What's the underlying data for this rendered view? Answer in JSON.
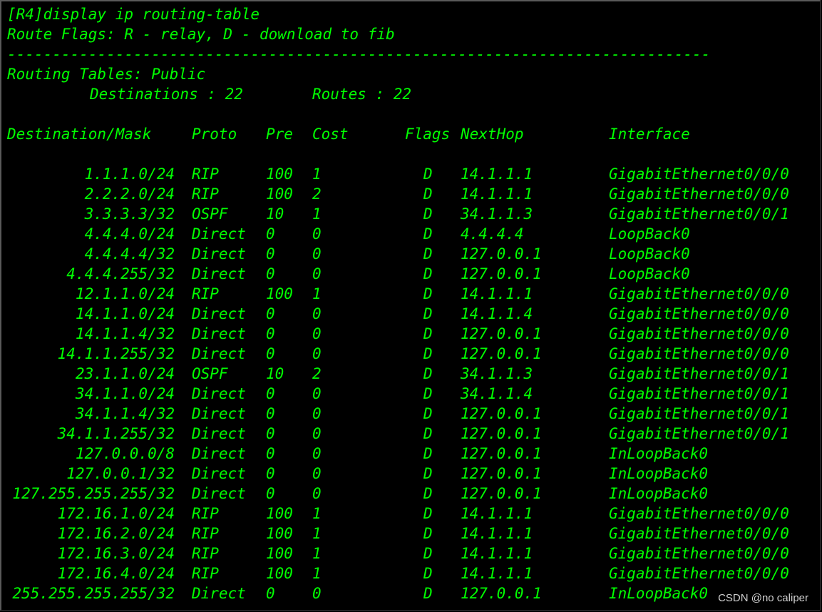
{
  "header": {
    "command": "[R4]display ip routing-table",
    "flags_legend": "Route Flags: R - relay, D - download to fib",
    "separator": "------------------------------------------------------------------------------",
    "tables_title": "Routing Tables: Public",
    "destinations": "Destinations : 22",
    "routes": "Routes : 22"
  },
  "columns": {
    "destination": "Destination/Mask",
    "proto": "Proto",
    "pre": "Pre",
    "cost": "Cost",
    "flags": "Flags",
    "nexthop": "NextHop",
    "interface": "Interface"
  },
  "rows": [
    {
      "dest": "1.1.1.0/24",
      "proto": "RIP",
      "pre": "100",
      "cost": "1",
      "flags": "D",
      "nexthop": "14.1.1.1",
      "iface": "GigabitEthernet0/0/0"
    },
    {
      "dest": "2.2.2.0/24",
      "proto": "RIP",
      "pre": "100",
      "cost": "2",
      "flags": "D",
      "nexthop": "14.1.1.1",
      "iface": "GigabitEthernet0/0/0"
    },
    {
      "dest": "3.3.3.3/32",
      "proto": "OSPF",
      "pre": "10",
      "cost": "1",
      "flags": "D",
      "nexthop": "34.1.1.3",
      "iface": "GigabitEthernet0/0/1"
    },
    {
      "dest": "4.4.4.0/24",
      "proto": "Direct",
      "pre": "0",
      "cost": "0",
      "flags": "D",
      "nexthop": "4.4.4.4",
      "iface": "LoopBack0"
    },
    {
      "dest": "4.4.4.4/32",
      "proto": "Direct",
      "pre": "0",
      "cost": "0",
      "flags": "D",
      "nexthop": "127.0.0.1",
      "iface": "LoopBack0"
    },
    {
      "dest": "4.4.4.255/32",
      "proto": "Direct",
      "pre": "0",
      "cost": "0",
      "flags": "D",
      "nexthop": "127.0.0.1",
      "iface": "LoopBack0"
    },
    {
      "dest": "12.1.1.0/24",
      "proto": "RIP",
      "pre": "100",
      "cost": "1",
      "flags": "D",
      "nexthop": "14.1.1.1",
      "iface": "GigabitEthernet0/0/0"
    },
    {
      "dest": "14.1.1.0/24",
      "proto": "Direct",
      "pre": "0",
      "cost": "0",
      "flags": "D",
      "nexthop": "14.1.1.4",
      "iface": "GigabitEthernet0/0/0"
    },
    {
      "dest": "14.1.1.4/32",
      "proto": "Direct",
      "pre": "0",
      "cost": "0",
      "flags": "D",
      "nexthop": "127.0.0.1",
      "iface": "GigabitEthernet0/0/0"
    },
    {
      "dest": "14.1.1.255/32",
      "proto": "Direct",
      "pre": "0",
      "cost": "0",
      "flags": "D",
      "nexthop": "127.0.0.1",
      "iface": "GigabitEthernet0/0/0"
    },
    {
      "dest": "23.1.1.0/24",
      "proto": "OSPF",
      "pre": "10",
      "cost": "2",
      "flags": "D",
      "nexthop": "34.1.1.3",
      "iface": "GigabitEthernet0/0/1"
    },
    {
      "dest": "34.1.1.0/24",
      "proto": "Direct",
      "pre": "0",
      "cost": "0",
      "flags": "D",
      "nexthop": "34.1.1.4",
      "iface": "GigabitEthernet0/0/1"
    },
    {
      "dest": "34.1.1.4/32",
      "proto": "Direct",
      "pre": "0",
      "cost": "0",
      "flags": "D",
      "nexthop": "127.0.0.1",
      "iface": "GigabitEthernet0/0/1"
    },
    {
      "dest": "34.1.1.255/32",
      "proto": "Direct",
      "pre": "0",
      "cost": "0",
      "flags": "D",
      "nexthop": "127.0.0.1",
      "iface": "GigabitEthernet0/0/1"
    },
    {
      "dest": "127.0.0.0/8",
      "proto": "Direct",
      "pre": "0",
      "cost": "0",
      "flags": "D",
      "nexthop": "127.0.0.1",
      "iface": "InLoopBack0"
    },
    {
      "dest": "127.0.0.1/32",
      "proto": "Direct",
      "pre": "0",
      "cost": "0",
      "flags": "D",
      "nexthop": "127.0.0.1",
      "iface": "InLoopBack0"
    },
    {
      "dest": "127.255.255.255/32",
      "proto": "Direct",
      "pre": "0",
      "cost": "0",
      "flags": "D",
      "nexthop": "127.0.0.1",
      "iface": "InLoopBack0"
    },
    {
      "dest": "172.16.1.0/24",
      "proto": "RIP",
      "pre": "100",
      "cost": "1",
      "flags": "D",
      "nexthop": "14.1.1.1",
      "iface": "GigabitEthernet0/0/0"
    },
    {
      "dest": "172.16.2.0/24",
      "proto": "RIP",
      "pre": "100",
      "cost": "1",
      "flags": "D",
      "nexthop": "14.1.1.1",
      "iface": "GigabitEthernet0/0/0"
    },
    {
      "dest": "172.16.3.0/24",
      "proto": "RIP",
      "pre": "100",
      "cost": "1",
      "flags": "D",
      "nexthop": "14.1.1.1",
      "iface": "GigabitEthernet0/0/0"
    },
    {
      "dest": "172.16.4.0/24",
      "proto": "RIP",
      "pre": "100",
      "cost": "1",
      "flags": "D",
      "nexthop": "14.1.1.1",
      "iface": "GigabitEthernet0/0/0"
    },
    {
      "dest": "255.255.255.255/32",
      "proto": "Direct",
      "pre": "0",
      "cost": "0",
      "flags": "D",
      "nexthop": "127.0.0.1",
      "iface": "InLoopBack0"
    }
  ],
  "watermark": "CSDN @no caliper",
  "colors": {
    "text": "#00ff00",
    "background": "#000000"
  }
}
